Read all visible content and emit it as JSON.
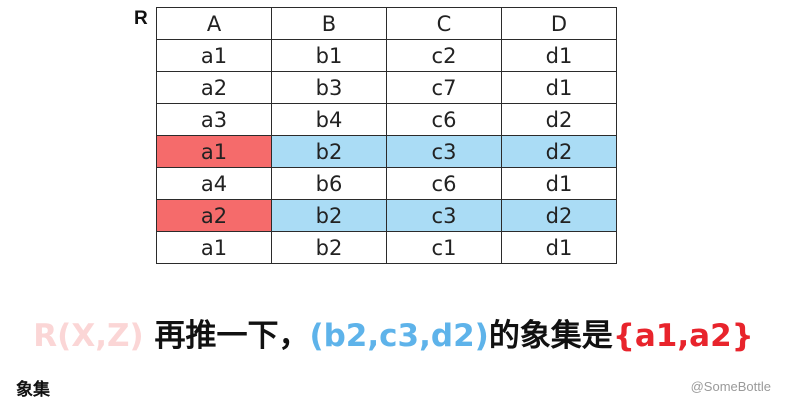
{
  "relation_name": "R",
  "columns": [
    "A",
    "B",
    "C",
    "D"
  ],
  "rows": [
    [
      "a1",
      "b1",
      "c2",
      "d1"
    ],
    [
      "a2",
      "b3",
      "c7",
      "d1"
    ],
    [
      "a3",
      "b4",
      "c6",
      "d2"
    ],
    [
      "a1",
      "b2",
      "c3",
      "d2"
    ],
    [
      "a4",
      "b6",
      "c6",
      "d1"
    ],
    [
      "a2",
      "b2",
      "c3",
      "d2"
    ],
    [
      "a1",
      "b2",
      "c1",
      "d1"
    ]
  ],
  "highlighted_rows": [
    3,
    5
  ],
  "colors": {
    "highlight_a": "#f56b6b",
    "highlight_bcd": "#aadcf5",
    "caption_blue": "#5eb3ea",
    "caption_red": "#e8242c"
  },
  "caption": {
    "part1": "R(X,Z)",
    "part2": " 再推一下，",
    "part3": "(b2,c3,d2)",
    "part4": "的象集是",
    "part5": "{a1,a2}"
  },
  "footer": {
    "left": "象集",
    "watermark": "@SomeBottle"
  }
}
